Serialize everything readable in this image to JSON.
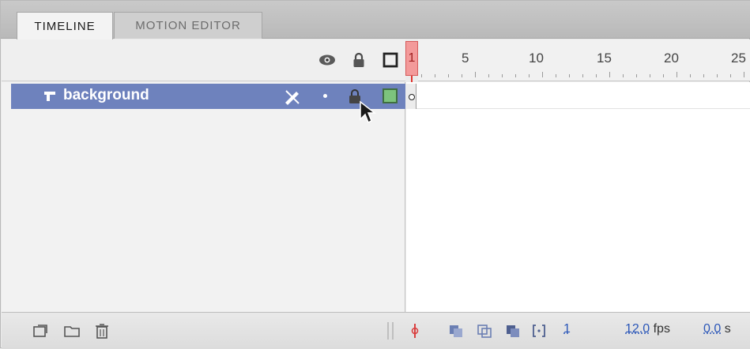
{
  "tabs": [
    {
      "label": "TIMELINE",
      "active": true
    },
    {
      "label": "MOTION EDITOR",
      "active": false
    }
  ],
  "header": {
    "icons": [
      "eye-icon",
      "lock-icon",
      "outline-icon"
    ]
  },
  "ruler": {
    "labels": [
      "1",
      "5",
      "10",
      "15",
      "20",
      "25"
    ]
  },
  "layers": [
    {
      "name": "background",
      "selected": true,
      "icons": [
        "layer-icon",
        "pencil-crossed-icon",
        "visibility-dot",
        "lock-icon",
        "outline-color-icon"
      ],
      "outline_color": "#7dc47d"
    }
  ],
  "playhead": {
    "frame": "1"
  },
  "bottom": {
    "left_icons": [
      "new-layer-icon",
      "new-folder-icon",
      "delete-icon"
    ],
    "current_frame": "1",
    "fps_value": "12.0",
    "fps_unit": "fps",
    "time_value": "0.0",
    "time_unit": "s"
  },
  "colors": {
    "selection": "#6e82bd",
    "playhead": "#e2352f"
  }
}
